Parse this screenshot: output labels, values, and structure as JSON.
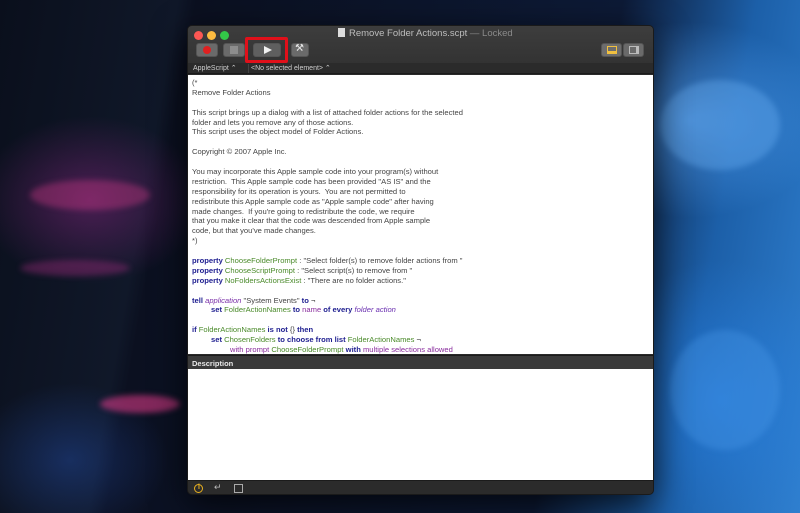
{
  "window": {
    "title": "Remove Folder Actions.scpt",
    "status": "— Locked"
  },
  "navbar": {
    "language": "AppleScript ⌃",
    "element": "<No selected element> ⌃"
  },
  "editor": {
    "lines": [
      "(*",
      "Remove Folder Actions",
      "",
      "This script brings up a dialog with a list of attached folder actions for the selected",
      "folder and lets you remove any of those actions.",
      "This script uses the object model of Folder Actions.",
      "",
      "Copyright © 2007 Apple Inc.",
      "",
      "You may incorporate this Apple sample code into your program(s) without",
      "restriction.  This Apple sample code has been provided \"AS IS\" and the",
      "responsibility for its operation is yours.  You are not permitted to",
      "redistribute this Apple sample code as \"Apple sample code\" after having",
      "made changes.  If you're going to redistribute the code, we require",
      "that you make it clear that the code was descended from Apple sample",
      "code, but that you've made changes.",
      "*)",
      ""
    ],
    "code": {
      "prop1_kw": "property ",
      "prop1_name": "ChooseFolderPrompt",
      "prop1_val": " : \"Select folder(s) to remove folder actions from \"",
      "prop2_kw": "property ",
      "prop2_name": "ChooseScriptPrompt",
      "prop2_val": " : \"Select script(s) to remove from \"",
      "prop3_kw": "property ",
      "prop3_name": "NoFoldersActionsExist",
      "prop3_val": " : \"There are no folder actions.\"",
      "tell_kw": "tell ",
      "tell_app": "application",
      "tell_str": " \"System Events\" ",
      "tell_to": "to",
      "tell_cont": " ¬",
      "set1_kw": "set ",
      "set1_var": "FolderActionNames",
      "set1_to": " to ",
      "set1_name": "name",
      "set1_of": " of every ",
      "set1_cls": "folder action",
      "if_kw": "if ",
      "if_var": "FolderActionNames",
      "if_isnot": " is not ",
      "if_list": "{} ",
      "if_then": "then",
      "set2_kw": "set ",
      "set2_var": "ChosenFolders",
      "set2_to": " to ",
      "set2_choose": "choose from list",
      "set2_arg": " FolderActionNames",
      "set2_cont": " ¬",
      "with_kw": "with prompt ",
      "with_var": "ChooseFolderPrompt",
      "with_kw2": " with ",
      "with_prop": "multiple selections allowed"
    }
  },
  "description": {
    "label": "Description"
  },
  "statusbar": {
    "info": "i",
    "return": "↵"
  },
  "icons": {
    "record": "record-icon",
    "stop": "stop-icon",
    "run": "play-icon",
    "compile": "hammer-icon",
    "view1": "bottom-pane-icon",
    "view2": "side-pane-icon"
  }
}
